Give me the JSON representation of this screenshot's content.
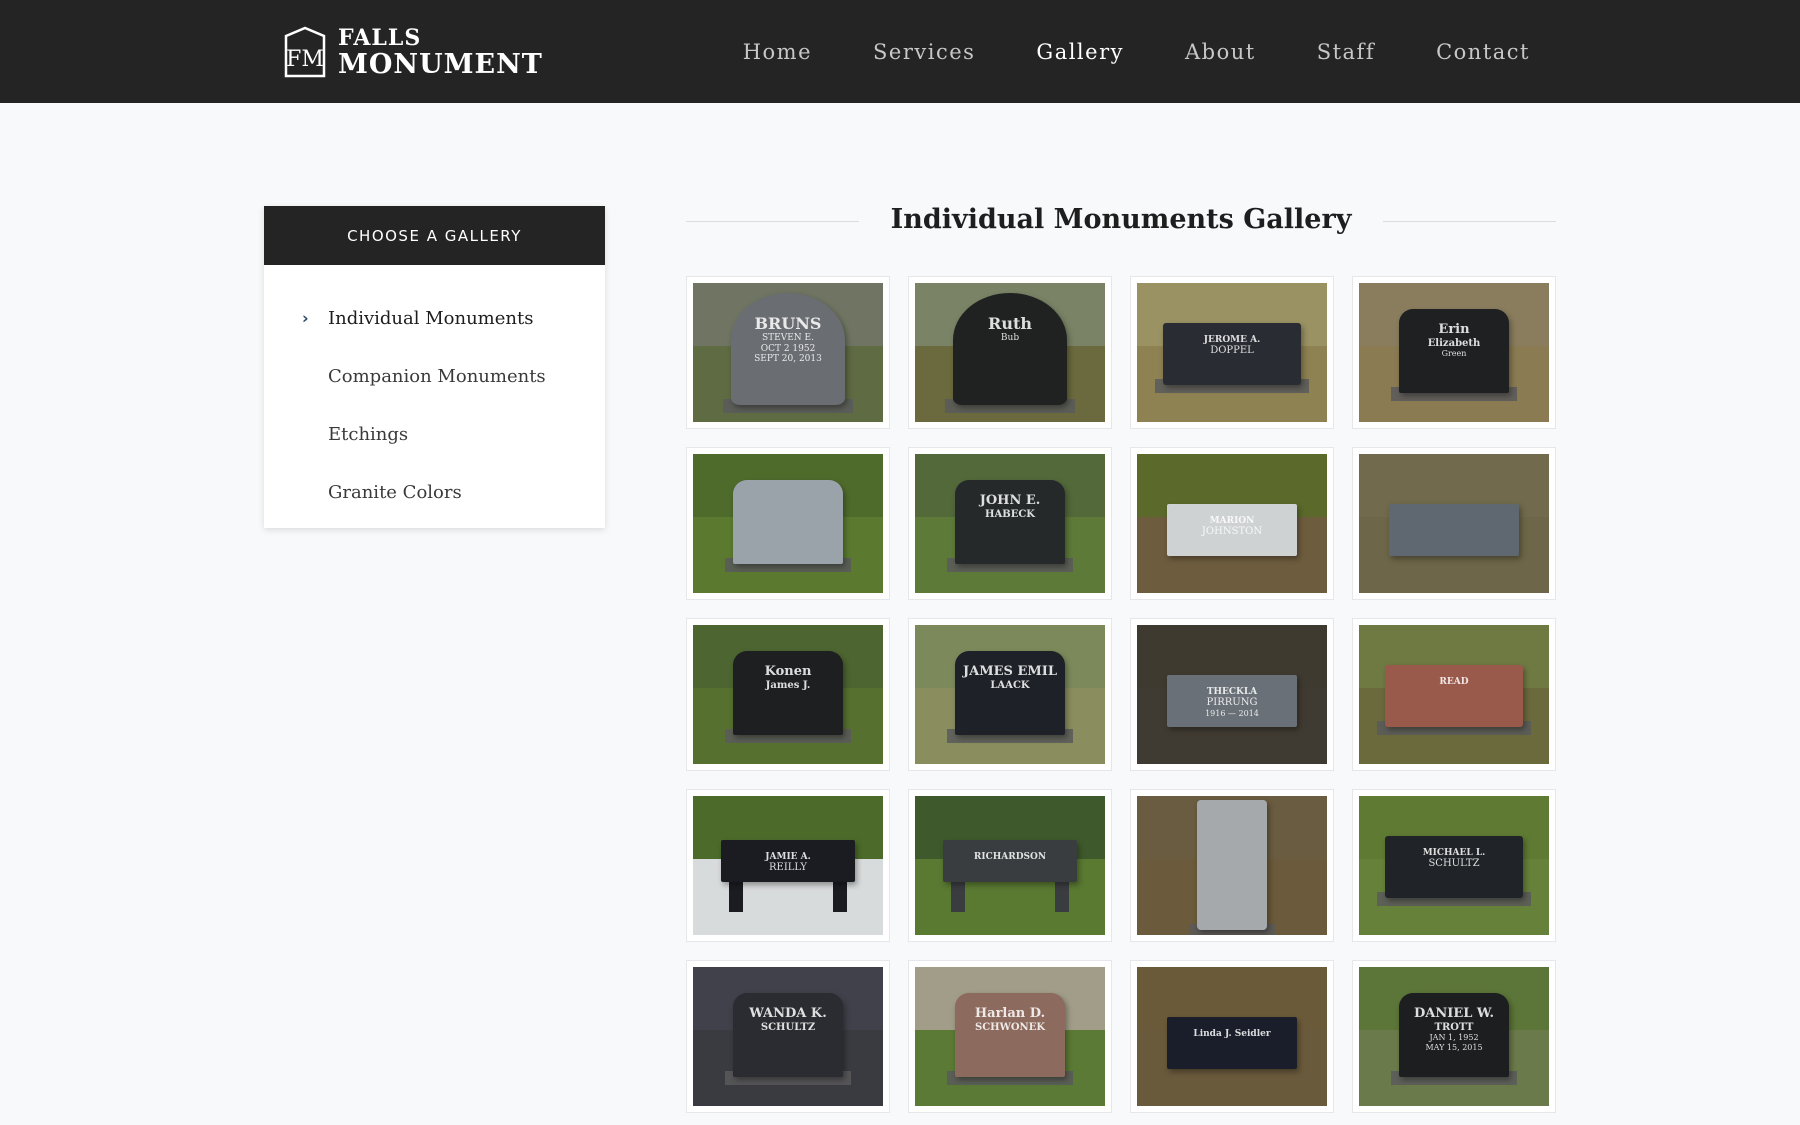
{
  "brand": {
    "line1": "FALLS",
    "line2": "MONUMENT",
    "mark": "FM"
  },
  "nav": {
    "items": [
      "Home",
      "Services",
      "Gallery",
      "About",
      "Staff",
      "Contact"
    ],
    "active": "Gallery"
  },
  "sidebar": {
    "heading": "CHOOSE A GALLERY",
    "items": [
      "Individual Monuments",
      "Companion Monuments",
      "Etchings",
      "Granite Colors"
    ],
    "active_index": 0
  },
  "gallery": {
    "title": "Individual Monuments Gallery",
    "photos": [
      {
        "name": "bruns-monument-photo",
        "sky": "#6f7562",
        "ground": "#5f6b43",
        "stone": "#6a6d71",
        "shape": "oval",
        "lines": [
          "BRUNS",
          "STEVEN E.",
          "OCT 2 1952",
          "SEPT 20, 2013"
        ]
      },
      {
        "name": "ruth-monument-photo",
        "sky": "#7a8366",
        "ground": "#6b6a3e",
        "stone": "#1f2220",
        "shape": "oval",
        "lines": [
          "Ruth",
          "Bub"
        ]
      },
      {
        "name": "doppel-monument-photo",
        "sky": "#9a9263",
        "ground": "#8e8152",
        "stone": "#2a2c33",
        "shape": "slant",
        "lines": [
          "JEROME A.",
          "DOPPEL"
        ]
      },
      {
        "name": "green-monument-photo",
        "sky": "#8a7d5e",
        "ground": "#8a7b52",
        "stone": "#1e2022",
        "shape": "upright",
        "lines": [
          "Erin",
          "Elizabeth",
          "Green"
        ]
      },
      {
        "name": "grey-upright-photo",
        "sky": "#4f6b2c",
        "ground": "#5b7a2f",
        "stone": "#9aa3aa",
        "shape": "upright",
        "lines": []
      },
      {
        "name": "habeck-monument-photo",
        "sky": "#53693a",
        "ground": "#5d7a39",
        "stone": "#25292a",
        "shape": "upright",
        "lines": [
          "JOHN E.",
          "HABECK"
        ]
      },
      {
        "name": "johnston-marker-photo",
        "sky": "#5b6a2b",
        "ground": "#6e5c3e",
        "stone": "#cfd2d3",
        "shape": "flat",
        "lines": [
          "MARION",
          "JOHNSTON"
        ]
      },
      {
        "name": "flat-grey-marker-photo",
        "sky": "#716a4d",
        "ground": "#6d6648",
        "stone": "#5f6870",
        "shape": "flat",
        "lines": []
      },
      {
        "name": "konen-book-monument-photo",
        "sky": "#4d6530",
        "ground": "#56702f",
        "stone": "#1d1f21",
        "shape": "upright",
        "lines": [
          "Konen",
          "James J."
        ]
      },
      {
        "name": "laack-monument-photo",
        "sky": "#7c8a5b",
        "ground": "#8a8d5e",
        "stone": "#1e2127",
        "shape": "upright",
        "lines": [
          "JAMES EMIL",
          "LAACK"
        ]
      },
      {
        "name": "pirrung-marker-photo",
        "sky": "#3f3a30",
        "ground": "#403b32",
        "stone": "#6a7077",
        "shape": "flat",
        "lines": [
          "THECKLA",
          "PIRRUNG",
          "1916 — 2014"
        ]
      },
      {
        "name": "read-monument-photo",
        "sky": "#6f7a42",
        "ground": "#6b6a3d",
        "stone": "#9a5a4b",
        "shape": "slant",
        "lines": [
          "READ"
        ]
      },
      {
        "name": "reilly-bench-photo",
        "sky": "#4c6a2a",
        "ground": "#d8dbdc",
        "stone": "#1a1c22",
        "shape": "bench",
        "lines": [
          "JAMIE A.",
          "REILLY"
        ]
      },
      {
        "name": "richardson-bench-photo",
        "sky": "#3e5a2c",
        "ground": "#5a7a32",
        "stone": "#3a3d40",
        "shape": "bench",
        "lines": [
          "RICHARDSON"
        ]
      },
      {
        "name": "schubert-monument-photo",
        "sky": "#6a5c40",
        "ground": "#6b5a3b",
        "stone": "#a6a9ab",
        "shape": "tall",
        "lines": []
      },
      {
        "name": "schultz-michael-photo",
        "sky": "#5e7a33",
        "ground": "#66823a",
        "stone": "#202327",
        "shape": "slant",
        "lines": [
          "MICHAEL L.",
          "SCHULTZ"
        ]
      },
      {
        "name": "wanda-schultz-photo",
        "sky": "#40414a",
        "ground": "#3a3b40",
        "stone": "#2a2c31",
        "shape": "upright",
        "lines": [
          "WANDA K.",
          "SCHULTZ"
        ]
      },
      {
        "name": "schwonek-monument-photo",
        "sky": "#a19d88",
        "ground": "#5a7a35",
        "stone": "#8c6a5e",
        "shape": "upright",
        "lines": [
          "Harlan D.",
          "SCHWONEK"
        ]
      },
      {
        "name": "seidler-marker-photo",
        "sky": "#6b5a3a",
        "ground": "#6a5a3c",
        "stone": "#1a1e2a",
        "shape": "flat",
        "lines": [
          "Linda J. Seidler"
        ]
      },
      {
        "name": "trott-monument-photo",
        "sky": "#5c7538",
        "ground": "#6a7a4a",
        "stone": "#1c1e20",
        "shape": "upright",
        "lines": [
          "DANIEL W.",
          "TROTT",
          "JAN 1, 1952",
          "MAY 15, 2015"
        ]
      }
    ]
  }
}
